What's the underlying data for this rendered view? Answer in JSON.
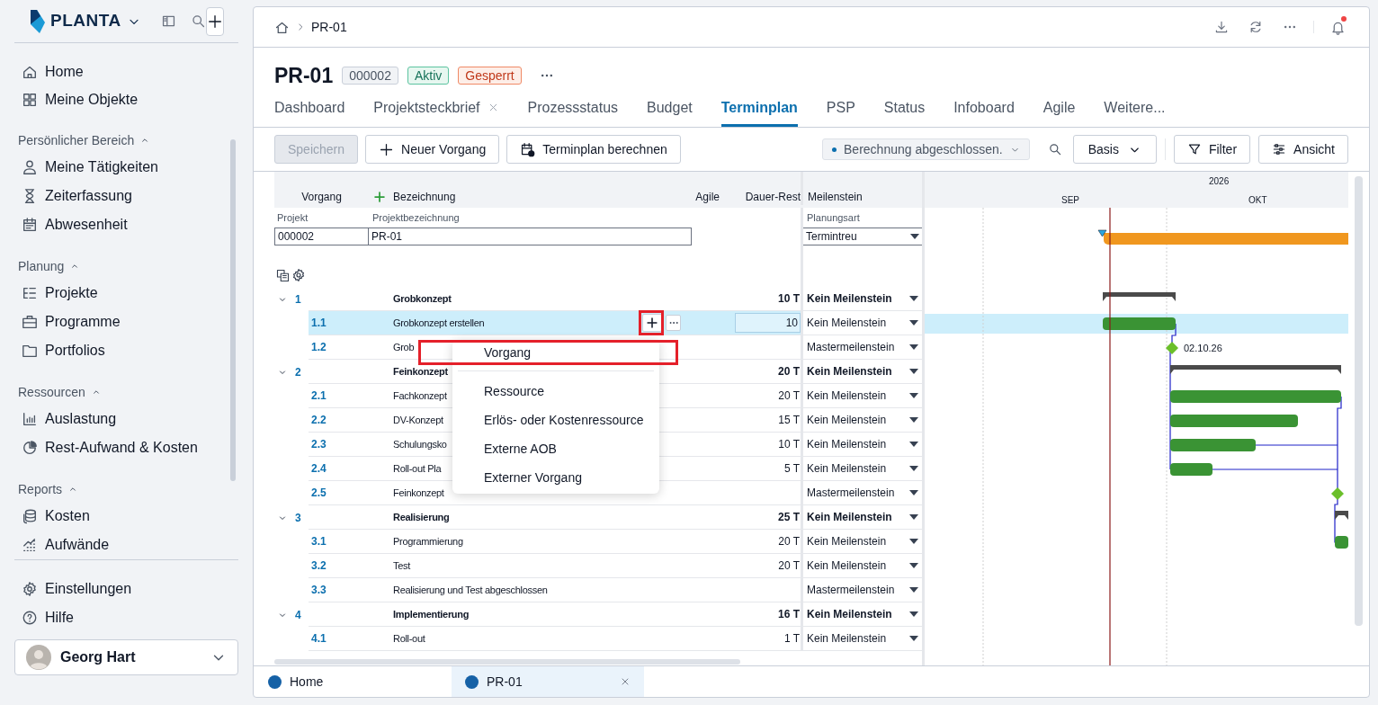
{
  "app": {
    "brand": "PLANTA"
  },
  "sidebar": {
    "top_items": [
      {
        "label": "Home"
      },
      {
        "label": "Meine Objekte"
      }
    ],
    "sections": [
      {
        "title": "Persönlicher Bereich",
        "expanded": true,
        "items": [
          {
            "label": "Meine Tätigkeiten"
          },
          {
            "label": "Zeiterfassung"
          },
          {
            "label": "Abwesenheit"
          }
        ]
      },
      {
        "title": "Planung",
        "expanded": true,
        "items": [
          {
            "label": "Projekte"
          },
          {
            "label": "Programme"
          },
          {
            "label": "Portfolios"
          }
        ]
      },
      {
        "title": "Ressourcen",
        "expanded": true,
        "items": [
          {
            "label": "Auslastung"
          },
          {
            "label": "Rest-Aufwand & Kosten"
          }
        ]
      },
      {
        "title": "Reports",
        "expanded": true,
        "items": [
          {
            "label": "Kosten"
          },
          {
            "label": "Aufwände"
          }
        ]
      }
    ],
    "bottom_items": [
      {
        "label": "Einstellungen"
      },
      {
        "label": "Hilfe"
      }
    ],
    "user": {
      "name": "Georg Hart"
    }
  },
  "breadcrumb": [
    "PR-01"
  ],
  "notifications": {
    "unread": true
  },
  "project": {
    "title": "PR-01",
    "badges": [
      {
        "text": "000002",
        "kind": "neutral"
      },
      {
        "text": "Aktiv",
        "kind": "success"
      },
      {
        "text": "Gesperrt",
        "kind": "danger"
      }
    ]
  },
  "tabs": [
    {
      "label": "Dashboard",
      "selected": false
    },
    {
      "label": "Projektsteckbrief",
      "selected": false,
      "closable": true
    },
    {
      "label": "Prozessstatus",
      "selected": false
    },
    {
      "label": "Budget",
      "selected": false
    },
    {
      "label": "Terminplan",
      "selected": true
    },
    {
      "label": "PSP",
      "selected": false
    },
    {
      "label": "Status",
      "selected": false
    },
    {
      "label": "Infoboard",
      "selected": false
    },
    {
      "label": "Agile",
      "selected": false
    },
    {
      "label": "Weitere...",
      "selected": false
    }
  ],
  "toolbar": {
    "buttons": [
      {
        "label": "Speichern",
        "disabled": true
      },
      {
        "label": "Neuer Vorgang",
        "disabled": false
      },
      {
        "label": "Terminplan berechnen",
        "disabled": false
      }
    ],
    "status": "Berechnung abgeschlossen.",
    "baseline": "Basis",
    "filter": "Filter",
    "view": "Ansicht"
  },
  "grid": {
    "columns": [
      "Vorgang",
      "Bezeichnung",
      "Agile",
      "Dauer-Rest",
      "Meilenstein"
    ],
    "project_columns": [
      "Projekt",
      "Projektbezeichnung",
      "Planungsart"
    ],
    "project_row": {
      "project": "000002",
      "name": "PR-01",
      "planning_type": "Termintreu"
    },
    "rows": [
      {
        "id": "1",
        "name": "Grobkonzept",
        "duration": "10 T",
        "milestone": "Kein Meilenstein",
        "kind": "summary",
        "expanded": true,
        "selected": false
      },
      {
        "id": "1.1",
        "name": "Grobkonzept erstellen",
        "duration": "10",
        "milestone": "Kein Meilenstein",
        "kind": "task",
        "selected": true
      },
      {
        "id": "1.2",
        "name": "Grob",
        "milestone": "Mastermeilenstein",
        "kind": "milestone",
        "selected": false,
        "gantt_label": "02.10.26"
      },
      {
        "id": "2",
        "name": "Feinkonzept",
        "duration": "20 T",
        "milestone": "Kein Meilenstein",
        "kind": "summary",
        "expanded": true,
        "selected": false
      },
      {
        "id": "2.1",
        "name": "Fachkonzept",
        "duration": "20 T",
        "milestone": "Kein Meilenstein",
        "kind": "task",
        "selected": false
      },
      {
        "id": "2.2",
        "name": "DV-Konzept",
        "duration": "15 T",
        "milestone": "Kein Meilenstein",
        "kind": "task",
        "selected": false
      },
      {
        "id": "2.3",
        "name": "Schulungsko",
        "duration": "10 T",
        "milestone": "Kein Meilenstein",
        "kind": "task",
        "selected": false
      },
      {
        "id": "2.4",
        "name": "Roll-out Pla",
        "duration": "5 T",
        "milestone": "Kein Meilenstein",
        "kind": "task",
        "selected": false
      },
      {
        "id": "2.5",
        "name": "Feinkonzept",
        "milestone": "Mastermeilenstein",
        "kind": "milestone",
        "selected": false
      },
      {
        "id": "3",
        "name": "Realisierung",
        "duration": "25 T",
        "milestone": "Kein Meilenstein",
        "kind": "summary",
        "expanded": true,
        "selected": false
      },
      {
        "id": "3.1",
        "name": "Programmierung",
        "duration": "20 T",
        "milestone": "Kein Meilenstein",
        "kind": "task",
        "selected": false
      },
      {
        "id": "3.2",
        "name": "Test",
        "duration": "20 T",
        "milestone": "Kein Meilenstein",
        "kind": "task",
        "selected": false
      },
      {
        "id": "3.3",
        "name": "Realisierung und Test abgeschlossen",
        "milestone": "Mastermeilenstein",
        "kind": "milestone",
        "selected": false
      },
      {
        "id": "4",
        "name": "Implementierung",
        "duration": "16 T",
        "milestone": "Kein Meilenstein",
        "kind": "summary",
        "expanded": true,
        "selected": false
      },
      {
        "id": "4.1",
        "name": "Roll-out",
        "duration": "1 T",
        "milestone": "Kein Meilenstein",
        "kind": "task",
        "selected": false
      }
    ]
  },
  "gantt": {
    "year": "2026",
    "months": [
      "SEP",
      "OKT"
    ]
  },
  "context_menu": {
    "items": [
      {
        "label": "Vorgang",
        "highlighted": true
      },
      {
        "label": "Ressource",
        "highlighted": false
      },
      {
        "label": "Erlös- oder Kostenressource",
        "highlighted": false
      },
      {
        "label": "Externe AOB",
        "highlighted": false
      },
      {
        "label": "Externer Vorgang",
        "highlighted": false
      }
    ]
  },
  "row_add_button": {
    "highlighted": true
  },
  "bottom_tabs": [
    {
      "label": "Home",
      "selected": false,
      "closable": false
    },
    {
      "label": "PR-01",
      "selected": true,
      "closable": true
    }
  ]
}
